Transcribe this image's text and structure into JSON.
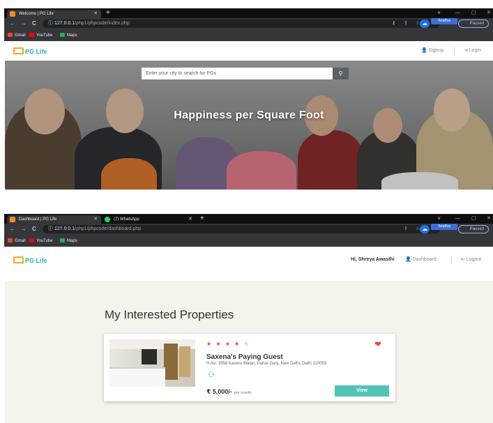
{
  "top_browser": {
    "tabs": [
      {
        "label": "Welcome | PG Life",
        "active": true
      }
    ],
    "new_tab": "+",
    "nav": {
      "back": "←",
      "forward": "→",
      "reload": "C"
    },
    "url": {
      "host": "127.0.0.1",
      "path": "/php1/phpcode/index.php"
    },
    "extensions": {
      "terabox": "TeraBox",
      "paused": "Paused"
    },
    "window_controls": {
      "minimize": "—",
      "maximize": "▢",
      "close": "✕",
      "dropdown": "∨"
    },
    "bookmarks": [
      {
        "label": "Gmail",
        "color": "#ea4335"
      },
      {
        "label": "YouTube",
        "color": "#ff0000"
      },
      {
        "label": "Maps",
        "color": "#34a853"
      }
    ]
  },
  "home_nav": {
    "logo": "PG Life",
    "signup": "Signup",
    "login": "Login"
  },
  "hero": {
    "title": "Happiness per Square Foot",
    "search_placeholder": "Enter your city to search for PGs",
    "search_icon": "search-icon"
  },
  "bottom_browser": {
    "tabs": [
      {
        "label": "Dashboard | PG Life",
        "active": true
      },
      {
        "label": "(7) WhatsApp",
        "active": false
      }
    ],
    "new_tab": "+",
    "nav": {
      "back": "←",
      "forward": "→",
      "reload": "C"
    },
    "url": {
      "host": "127.0.0.1",
      "path": "/php1/phpcode/dashboard.php"
    },
    "extensions": {
      "terabox": "TeraBox",
      "paused": "Paused"
    },
    "bookmarks": [
      {
        "label": "Gmail",
        "color": "#ea4335"
      },
      {
        "label": "YouTube",
        "color": "#ff0000"
      },
      {
        "label": "Maps",
        "color": "#34a853"
      }
    ]
  },
  "dash_nav": {
    "logo": "PG Life",
    "greeting": "Hi, Shreya Awasthi",
    "dashboard": "Dashboard",
    "logout": "Logout"
  },
  "dashboard": {
    "title": "My Interested Properties",
    "property": {
      "rating_stars": "★ ★ ★ ★ ☆",
      "name": "Saxena's Paying Guest",
      "address": "H.No. 3958 Kaseru Walan, Pahar Ganj, New Delhi, Delhi 110055",
      "rent": "₹ 5,000/-",
      "rent_unit": "per month",
      "view_label": "View"
    }
  },
  "colors": {
    "accent": "#27b4a8",
    "logo_house": "#f5a623",
    "star": "#e04848",
    "view_button": "#52c4b6"
  }
}
